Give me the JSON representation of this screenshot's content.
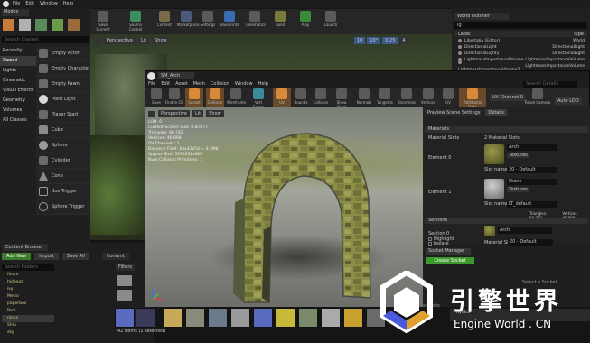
{
  "main_menu": [
    "File",
    "Edit",
    "Window",
    "Help"
  ],
  "modes_tab": "Modes",
  "toolbar": {
    "items": [
      "Save Current",
      "Source Control",
      "Content",
      "Marketplace",
      "Settings",
      "Blueprints",
      "Cinematics",
      "Build",
      "Play",
      "Launch"
    ]
  },
  "place": {
    "search_placeholder": "Search Classes",
    "categories": [
      "Recently Placed",
      "Basic",
      "Lights",
      "Cinematic",
      "Visual Effects",
      "Geometry",
      "Volumes",
      "All Classes"
    ],
    "items": [
      "Empty Actor",
      "Empty Character",
      "Empty Pawn",
      "Point Light",
      "Player Start",
      "Cube",
      "Sphere",
      "Cylinder",
      "Cone",
      "Box Trigger",
      "Sphere Trigger"
    ]
  },
  "viewport": {
    "mode": "Perspective",
    "lit": "Lit",
    "show": "Show",
    "snap1": "10",
    "snap2": "10°",
    "scale": "0.25",
    "cam": "4"
  },
  "outliner": {
    "title": "World Outliner",
    "search": "Ig",
    "col_label": "Label",
    "col_type": "Type",
    "rows": [
      {
        "label": "Libertalia (Editor)",
        "type": "World"
      },
      {
        "label": "DirectionalLight",
        "type": "DirectionalLight"
      },
      {
        "label": "DirectionalLight2",
        "type": "DirectionalLight"
      },
      {
        "label": "LightmassImportanceVolume",
        "type": "LightmassImportanceVolume"
      },
      {
        "label": "LightmassImportanceVolume2",
        "type": "LightmassImportanceVolume"
      },
      {
        "label": "PointLight",
        "type": "PointLight"
      },
      {
        "label": "PointLight2",
        "type": "PointLight"
      },
      {
        "label": "PointLight3",
        "type": "PointLight"
      }
    ]
  },
  "content_browser": {
    "title": "Content Browser",
    "add_new": "Add New",
    "import": "Import",
    "save_all": "Save All",
    "path": "Content",
    "filters": "Filters",
    "search_folders": "Search Folders",
    "folders": [
      "fence",
      "hideout",
      "ivy",
      "Metro",
      "paperbox",
      "Pool",
      "rocks",
      "Ship",
      "sky",
      "textures",
      "tire",
      "Tower"
    ],
    "status": "42 items (1 selected)"
  },
  "sm_editor": {
    "tab": "SM_Arch",
    "menu": [
      "File",
      "Edit",
      "Asset",
      "Mesh",
      "Collision",
      "Window",
      "Help"
    ],
    "toolbar": [
      "Save",
      "Find in CB",
      "Socket",
      "Collision",
      "Wireframe",
      "Vert Colors",
      "UV",
      "Bounds",
      "Collision",
      "Show Pivot",
      "Normals",
      "Tangents",
      "Binormals",
      "Vertices",
      "UV",
      "Additional Data",
      "UV Channel 0",
      "Reset Camera",
      "Auto LOD"
    ],
    "search_details": "Search Details",
    "stats": [
      "LOD: 0",
      "Current Screen Size: 0.87077",
      "Triangles: 80,742",
      "Vertices: 46,898",
      "UV Channels: 2",
      "Distance Field: 64x42x54 = 0.3Mb",
      "Approx Size: 537x238x862",
      "Num Collision Primitives: 1"
    ],
    "details": {
      "tabs": [
        "Preview Scene Settings",
        "Details"
      ],
      "materials_header": "Materials",
      "material_slots_label": "Material Slots",
      "material_slots_value": "2 Material Slots",
      "elements": [
        {
          "label": "Element 0",
          "material": "Arch",
          "textures": "Textures",
          "slot_label": "Slot name",
          "slot_value": "20 - Default"
        },
        {
          "label": "Element 1",
          "material": "Stone",
          "textures": "Textures",
          "slot_label": "Slot name",
          "slot_value": "LT_default"
        }
      ],
      "triangles_label": "Triangles: 80,742",
      "vertices_label": "Vertices: 46,898",
      "sections_header": "Sections",
      "section_label": "Section 0",
      "section_material": "Arch",
      "highlight": "Highlight",
      "isolate": "Isolate",
      "material_slot_label": "Material Slot",
      "material_slot_value": "20 - Default"
    },
    "socket_manager": {
      "title": "Socket Manager",
      "create_button": "Create Socket",
      "hint": "Select a Socket"
    },
    "sockets_label": "sockets",
    "physics": "Physics"
  },
  "watermark": {
    "title": "引擎世界",
    "subtitle": "Engine World . CN"
  }
}
